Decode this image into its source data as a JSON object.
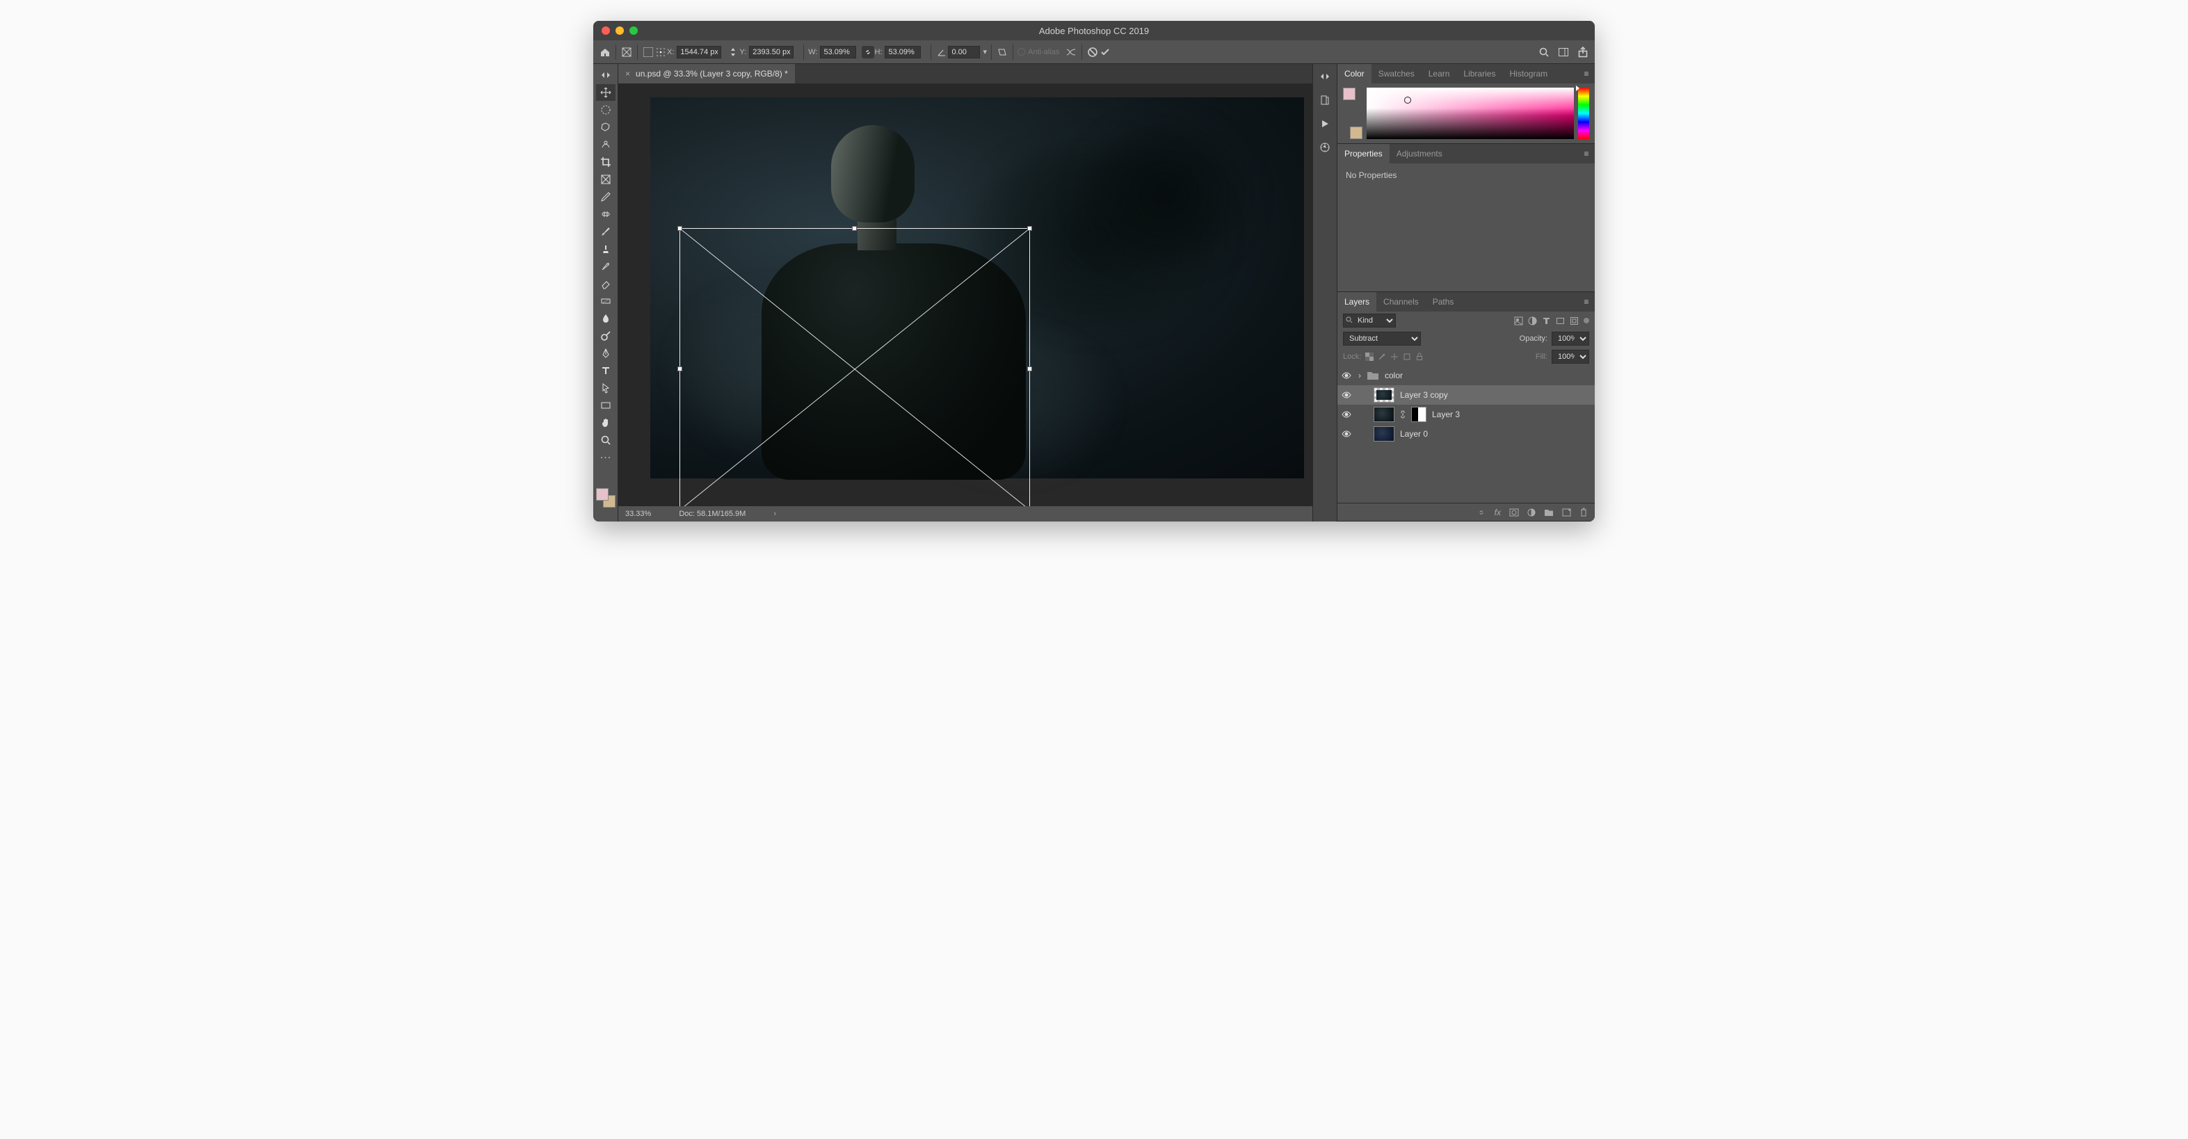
{
  "app": {
    "title": "Adobe Photoshop CC 2019"
  },
  "options": {
    "x_label": "X:",
    "x_value": "1544.74 px",
    "y_label": "Y:",
    "y_value": "2393.50 px",
    "w_label": "W:",
    "w_value": "53.09%",
    "h_label": "H:",
    "h_value": "53.09%",
    "angle_value": "0.00",
    "antialias_label": "Anti-alias"
  },
  "document": {
    "tab_title": "un.psd @ 33.3% (Layer 3 copy, RGB/8) *",
    "zoom": "33.33%",
    "doc_info": "Doc: 58.1M/165.9M"
  },
  "panels": {
    "color": {
      "tabs": [
        "Color",
        "Swatches",
        "Learn",
        "Libraries",
        "Histogram"
      ],
      "fg": "#e6c1c9",
      "bg": "#d2b98f"
    },
    "properties": {
      "tabs": [
        "Properties",
        "Adjustments"
      ],
      "message": "No Properties"
    },
    "layers": {
      "tabs": [
        "Layers",
        "Channels",
        "Paths"
      ],
      "kind_label": "Kind",
      "blend_mode": "Subtract",
      "opacity_label": "Opacity:",
      "opacity_value": "100%",
      "lock_label": "Lock:",
      "fill_label": "Fill:",
      "fill_value": "100%",
      "items": [
        {
          "name": "color",
          "type": "group"
        },
        {
          "name": "Layer 3 copy",
          "type": "layer",
          "selected": true
        },
        {
          "name": "Layer 3",
          "type": "layer",
          "mask": true
        },
        {
          "name": "Layer 0",
          "type": "layer"
        }
      ]
    }
  },
  "tools": {
    "fg": "#e6c1c9",
    "bg": "#d2b98f"
  }
}
